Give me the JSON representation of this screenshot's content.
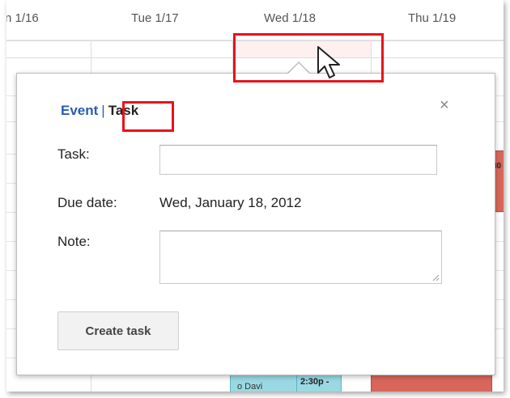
{
  "calendar": {
    "days": [
      "n 1/16",
      "Tue 1/17",
      "Wed 1/18",
      "Thu 1/19"
    ],
    "event_fragments": {
      "right_edge": "30",
      "bottom_teal": "o Davi",
      "bottom_time": "2:30p -"
    }
  },
  "popup": {
    "tab_event": "Event",
    "tab_separator": "|",
    "tab_task": "Task",
    "close_symbol": "×",
    "task_label": "Task:",
    "task_value": "",
    "due_label": "Due date:",
    "due_value": "Wed, January 18, 2012",
    "note_label": "Note:",
    "note_value": "",
    "create_button": "Create task"
  },
  "colors": {
    "highlight": "#e8131b",
    "link": "#2a5db0",
    "event_red": "#d9665a",
    "event_teal": "#9ad9e3"
  }
}
